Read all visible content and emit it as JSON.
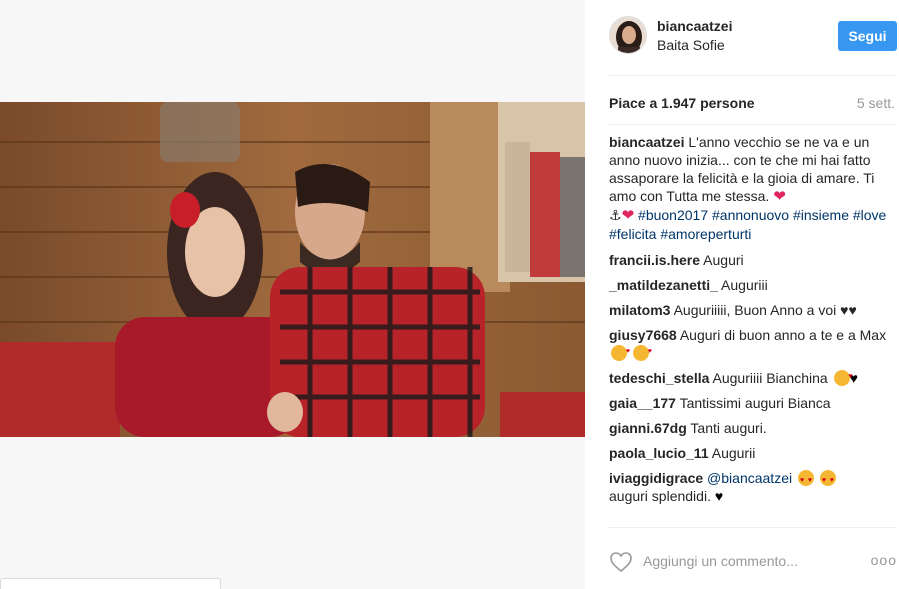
{
  "post": {
    "username": "biancaatzei",
    "location": "Baita Sofie",
    "follow_label": "Segui",
    "likes_text": "Piace a 1.947 persone",
    "time_text": "5 sett."
  },
  "caption": {
    "user": "biancaatzei",
    "text": " L'anno vecchio se ne va e un anno nuovo inizia... con te che mi hai fatto assaporare la felicità e la gioia di amare. Ti amo con Tutta me stessa. ",
    "hashtags": "#buon2017 #annonuovo #insieme #love #felicita #amoreperturti"
  },
  "comments": [
    {
      "user": "francii.is.here",
      "text": " Auguri"
    },
    {
      "user": "_matildezanetti_",
      "text": "  Auguriii"
    },
    {
      "user": "milatom3",
      "text": " Auguriiiii, Buon Anno a voi ♥♥"
    },
    {
      "user": "giusy7668",
      "text": " Auguri di buon anno a te e a Max "
    },
    {
      "user": "tedeschi_stella",
      "text": " Auguriiii Bianchina "
    },
    {
      "user": "gaia__177",
      "text": " Tantissimi auguri Bianca"
    },
    {
      "user": "gianni.67dg",
      "text": " Tanti auguri."
    },
    {
      "user": "paola_lucio_11",
      "text": " Augurii"
    },
    {
      "user": "iviaggidigrace",
      "mention": "@biancaatzei",
      "text": "auguri splendidi. "
    }
  ],
  "footer": {
    "add_comment_placeholder": "Aggiungi un commento...",
    "more_label": "ooo"
  },
  "icons": {
    "avatar": "profile-picture",
    "like": "heart-outline-icon",
    "more": "more-options-icon"
  },
  "colors": {
    "follow_button": "#3897f0",
    "hashtag": "#003569",
    "heart": "#e0245e"
  }
}
